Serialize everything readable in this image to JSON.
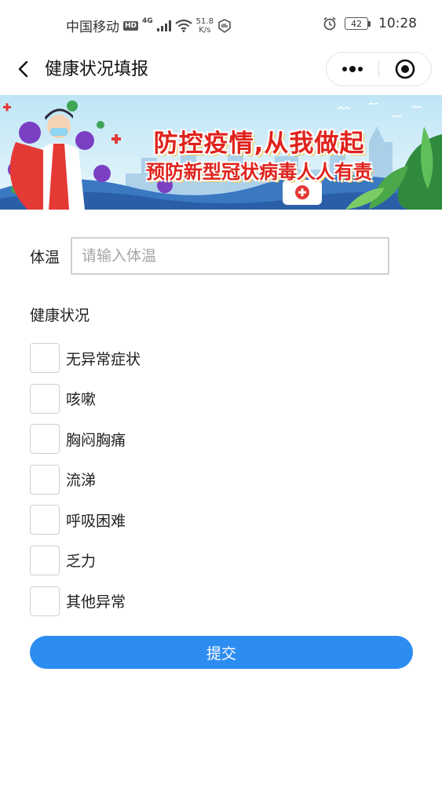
{
  "status_bar": {
    "carrier": "中国移动",
    "hd": "HD",
    "network": "4G",
    "speed_value": "51.8",
    "speed_unit": "K/s",
    "battery": "42",
    "time": "10:28"
  },
  "nav": {
    "title": "健康状况填报"
  },
  "banner": {
    "line1": "防控疫情,从我做起",
    "line2": "预防新型冠状病毒人人有责"
  },
  "form": {
    "temperature_label": "体温",
    "temperature_placeholder": "请输入体温",
    "temperature_value": "",
    "health_label": "健康状况",
    "options": [
      {
        "label": "无异常症状",
        "checked": false
      },
      {
        "label": "咳嗽",
        "checked": false
      },
      {
        "label": "胸闷胸痛",
        "checked": false
      },
      {
        "label": "流涕",
        "checked": false
      },
      {
        "label": "呼吸困难",
        "checked": false
      },
      {
        "label": "乏力",
        "checked": false
      },
      {
        "label": "其他异常",
        "checked": false
      }
    ],
    "submit_label": "提交"
  },
  "colors": {
    "accent": "#2d8cf0",
    "banner_text": "#e0221c",
    "border": "#cfcfcf"
  }
}
